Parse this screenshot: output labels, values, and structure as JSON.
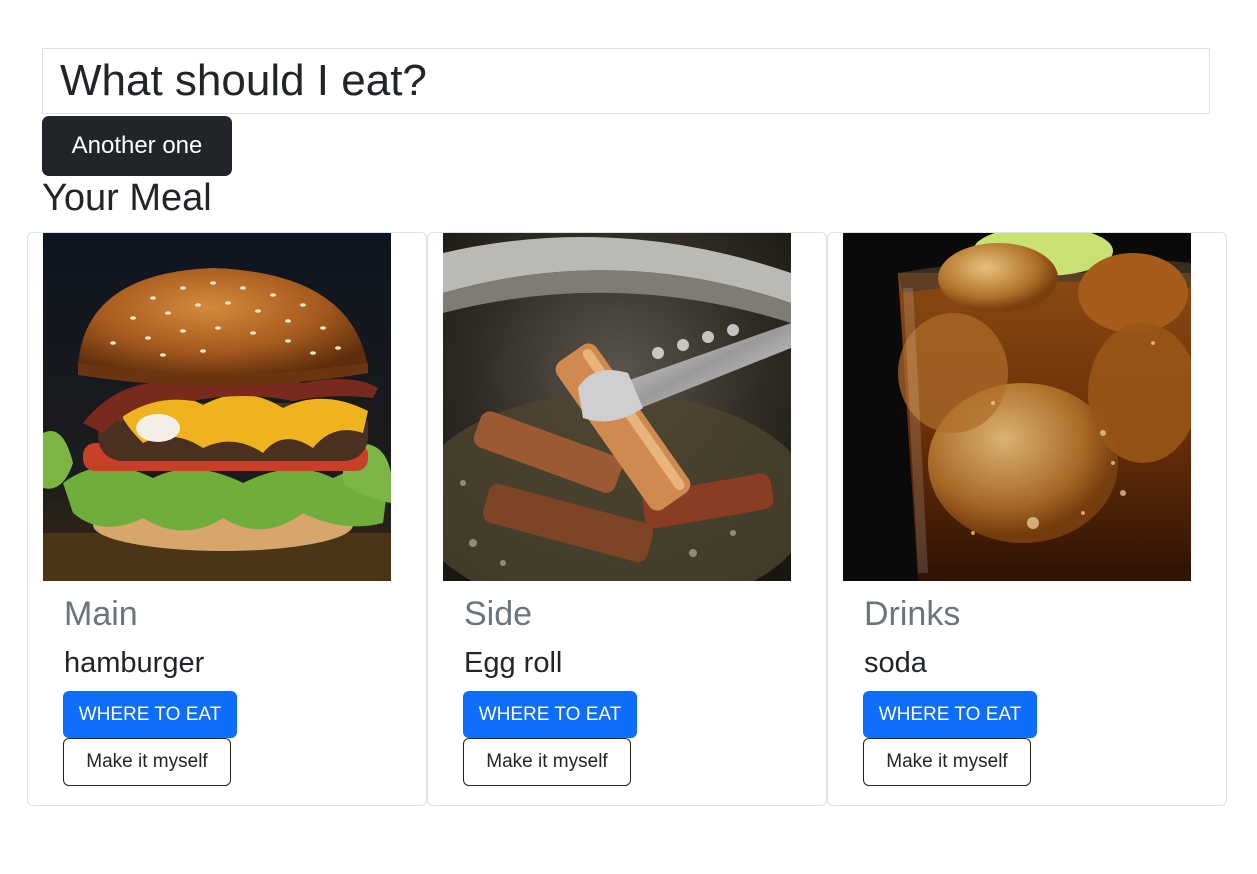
{
  "header": {
    "title": "What should I eat?",
    "another_button": "Another one"
  },
  "meal": {
    "section_title": "Your Meal",
    "cards": [
      {
        "category": "Main",
        "item": "hamburger",
        "image": "hamburger-photo",
        "where_button": "WHERE TO EAT",
        "make_button": "Make it myself"
      },
      {
        "category": "Side",
        "item": "Egg roll",
        "image": "egg-roll-photo",
        "where_button": "WHERE TO EAT",
        "make_button": "Make it myself"
      },
      {
        "category": "Drinks",
        "item": "soda",
        "image": "soda-photo",
        "where_button": "WHERE TO EAT",
        "make_button": "Make it myself"
      }
    ]
  },
  "colors": {
    "primary": "#0d6efd",
    "dark": "#212529",
    "muted": "#6c757d",
    "border": "#dee2e6"
  }
}
